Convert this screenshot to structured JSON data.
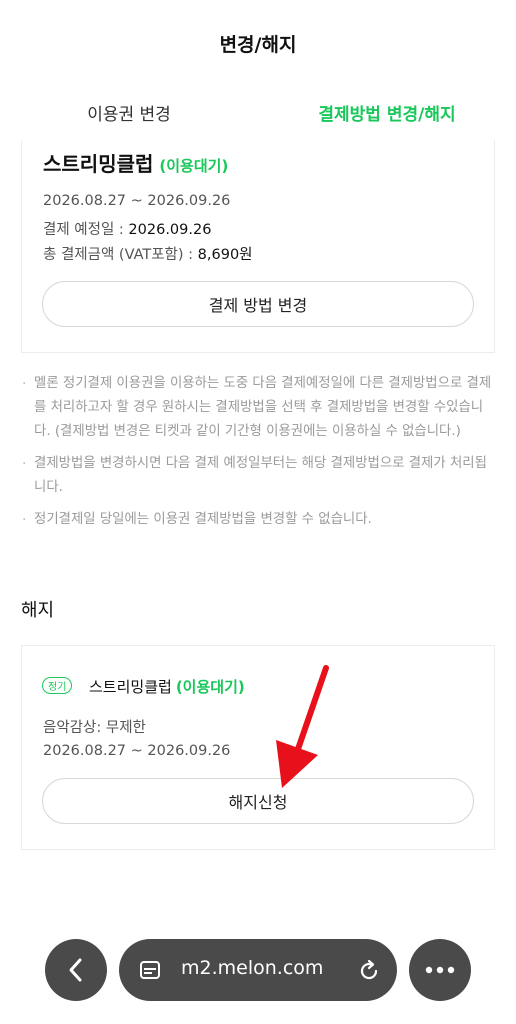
{
  "header": {
    "title": "변경/해지"
  },
  "tabs": [
    {
      "label": "이용권 변경",
      "active": false
    },
    {
      "label": "결제방법 변경/해지",
      "active": true
    }
  ],
  "payment_card": {
    "plan_name": "스트리밍클럽",
    "status": "(이용대기)",
    "period": "2026.08.27 ~ 2026.09.26",
    "next_payment_label": "결제 예정일 : ",
    "next_payment_value": "2026.09.26",
    "total_label": "총 결제금액 (VAT포함) : ",
    "total_value": "8,690원",
    "change_button": "결제 방법 변경"
  },
  "notes": [
    "멜론 정기결제 이용권을 이용하는 도중 다음 결제예정일에 다른 결제방법으로 결제를 처리하고자 할 경우 원하시는 결제방법을 선택 후 결제방법을 변경할 수있습니다. (결제방법 변경은 티켓과 같이 기간형 이용권에는 이용하실 수 없습니다.)",
    "결제방법을 변경하시면 다음 결제 예정일부터는 해당 결제방법으로 결제가 처리됩니다.",
    "정기결제일 당일에는 이용권 결제방법을 변경할 수 없습니다."
  ],
  "cancel_section": {
    "title": "해지",
    "badge": "정기",
    "plan_name": "스트리밍클럽",
    "status": "(이용대기)",
    "music_label": "음악감상: 무제한",
    "period": "2026.08.27 ~ 2026.09.26",
    "cancel_button": "해지신청"
  },
  "browser": {
    "url": "m2.melon.com",
    "icons": [
      "back-chevron-icon",
      "page-icon",
      "reload-icon",
      "more-icon"
    ]
  },
  "colors": {
    "accent": "#19c75a",
    "arrow": "#e8101a",
    "browser_bar": "#4a4a4a"
  }
}
